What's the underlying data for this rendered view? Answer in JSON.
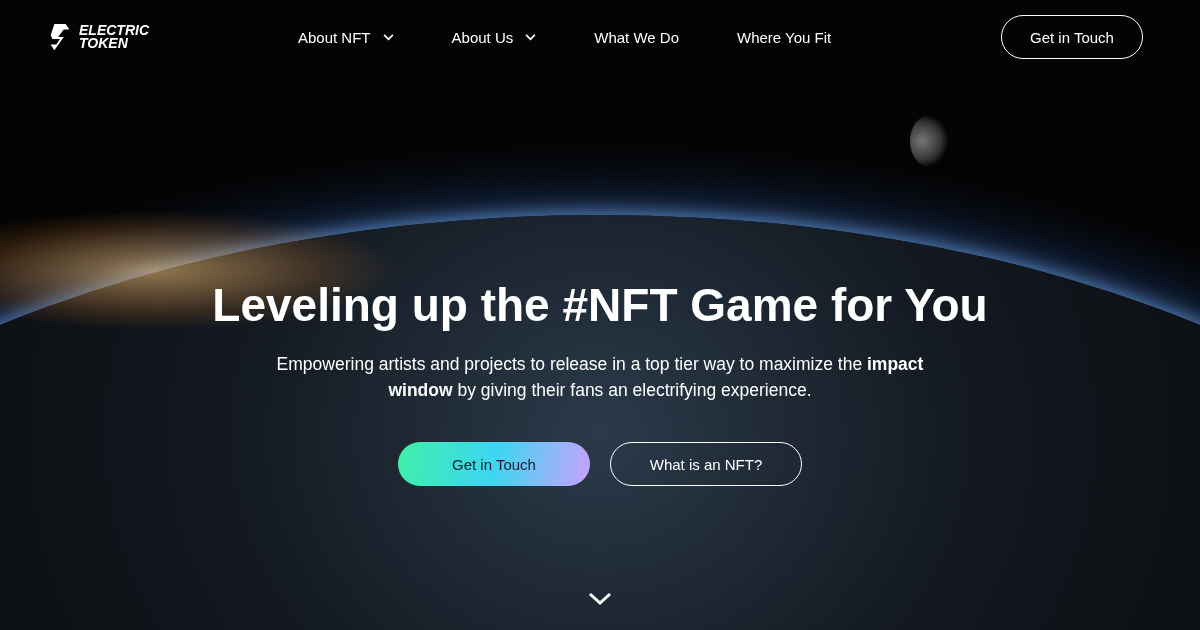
{
  "logo": {
    "lines": [
      "ELECTRIC",
      "TOKEN"
    ]
  },
  "nav": [
    {
      "label": "About NFT",
      "has_dropdown": true
    },
    {
      "label": "About Us",
      "has_dropdown": true
    },
    {
      "label": "What We Do",
      "has_dropdown": false
    },
    {
      "label": "Where You Fit",
      "has_dropdown": false
    }
  ],
  "header_button": "Get in Touch",
  "hero": {
    "title": "Leveling up the #NFT Game for You",
    "subtitle": "Empowering artists and projects to release in a top tier way to maximize the **impact window** by giving their fans an electrifying experience.",
    "buttons": [
      {
        "label": "Get in Touch",
        "kind": "primary"
      },
      {
        "label": "What is an NFT?",
        "kind": "outline"
      }
    ]
  }
}
